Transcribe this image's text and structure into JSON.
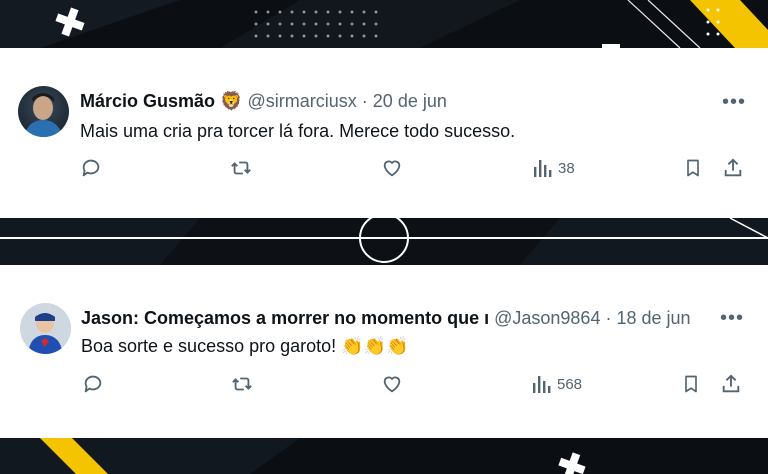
{
  "tweets": [
    {
      "name": "Márcio Gusmão",
      "badge": "🦁",
      "handle": "@sirmarciusx",
      "date": "· 20 de jun",
      "text": "Mais uma cria pra torcer lá fora. Merece todo sucesso.",
      "views": "38",
      "more": "•••"
    },
    {
      "name": "Jason: Começamos a morrer no momento que ı",
      "handle": "@Jason9864",
      "date": "· 18 de jun",
      "text": "Boa sorte e sucesso pro garoto! 👏👏👏",
      "views": "568",
      "more": "•••"
    }
  ],
  "icons": [
    "reply-icon",
    "retweet-icon",
    "like-icon",
    "views-icon",
    "bookmark-icon",
    "share-icon"
  ],
  "colors": {
    "accent_yellow": "#f5c400",
    "background": "#0b0e12",
    "text": "#0f1419",
    "muted": "#536471"
  }
}
